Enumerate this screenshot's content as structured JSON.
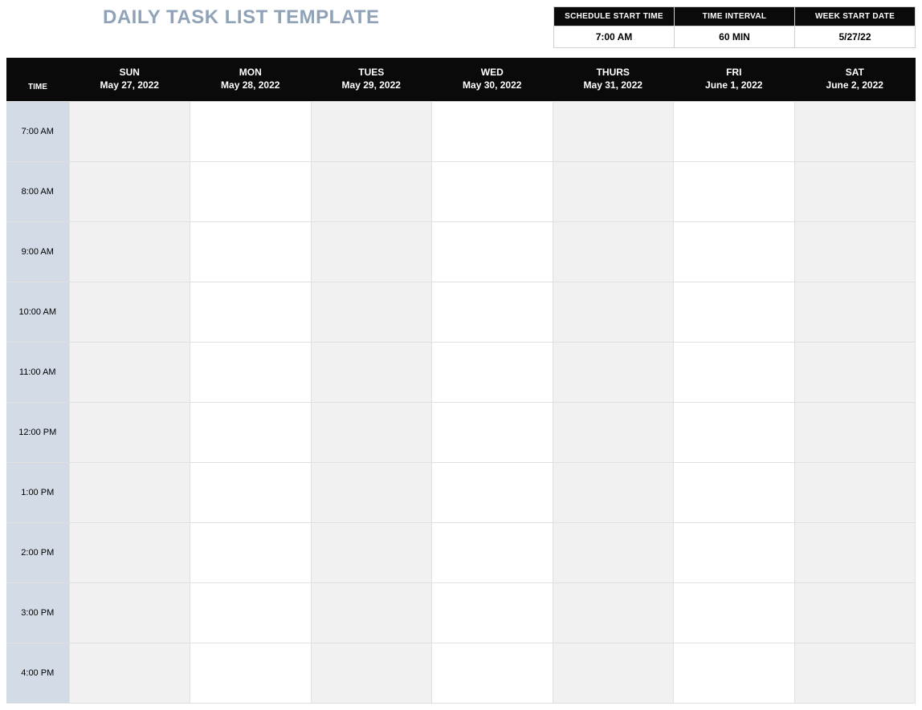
{
  "title": "DAILY TASK LIST TEMPLATE",
  "settings": {
    "headers": {
      "start_time": "SCHEDULE START TIME",
      "interval": "TIME INTERVAL",
      "week_start": "WEEK START DATE"
    },
    "values": {
      "start_time": "7:00 AM",
      "interval": "60 MIN",
      "week_start": "5/27/22"
    }
  },
  "grid_header": {
    "time_label": "TIME",
    "days": [
      {
        "dow": "SUN",
        "date": "May 27, 2022"
      },
      {
        "dow": "MON",
        "date": "May 28, 2022"
      },
      {
        "dow": "TUES",
        "date": "May 29, 2022"
      },
      {
        "dow": "WED",
        "date": "May 30, 2022"
      },
      {
        "dow": "THURS",
        "date": "May 31, 2022"
      },
      {
        "dow": "FRI",
        "date": "June 1, 2022"
      },
      {
        "dow": "SAT",
        "date": "June 2, 2022"
      }
    ]
  },
  "time_slots": [
    "7:00 AM",
    "8:00 AM",
    "9:00 AM",
    "10:00 AM",
    "11:00 AM",
    "12:00 PM",
    "1:00 PM",
    "2:00 PM",
    "3:00 PM",
    "4:00 PM"
  ]
}
